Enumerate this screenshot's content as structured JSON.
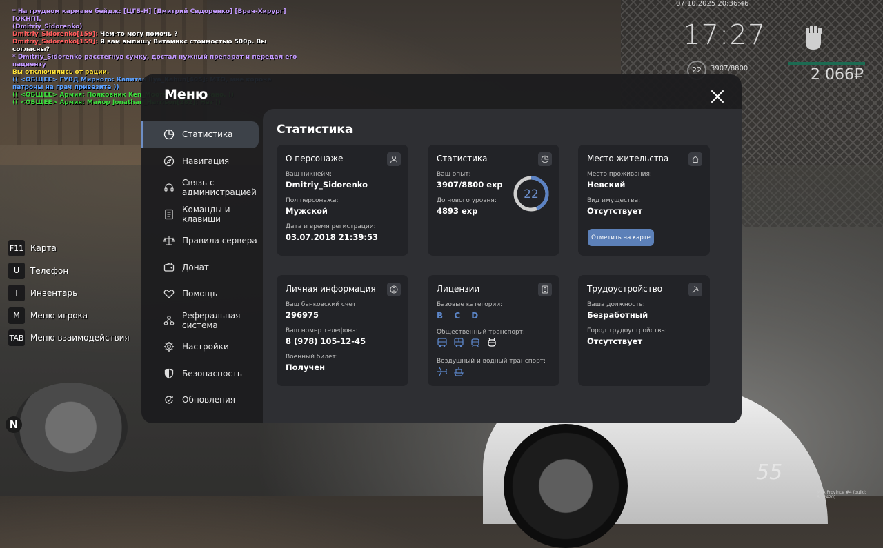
{
  "chat": [
    {
      "color": "purple",
      "text": "* На грудном кармане бейдж: [ЦГБ-Н] [Дмитрий Сидоренко] [Врач-Хирург] [ОКНП]."
    },
    {
      "color": "purple",
      "text": "(Dmitriy_Sidorenko)"
    },
    {
      "color": "red",
      "name": "Dmitriy_Sidorenko[159]:",
      "text": " Чем-то могу помочь ?"
    },
    {
      "color": "red",
      "name": "Dmitriy_Sidorenko[159]:",
      "text": " Я вам выпишу Витамикс стоимостью 500р. Вы согласны?"
    },
    {
      "color": "purple",
      "text": "* Dmitriy_Sidorenko расстегнув сумку, достал нужный препарат и передал его пациенту"
    },
    {
      "color": "yellow",
      "text": "Вы отключились от рации."
    },
    {
      "color": "blue",
      "text": "(( <ОБЩЕЕ> ГУВД Мирного: Капитан Ilya_Kahun[405]: МТО, мне короче патроны на грач привезите ))"
    },
    {
      "color": "green",
      "text": "(( <ОБЩЕЕ> Армия: Полковник Ken_Moore[289]: Отказано. ))"
    },
    {
      "color": "green",
      "text": "(( <ОБЩЕЕ> Армия: Майор Jonathan_Harrison[282]: Нет ))"
    }
  ],
  "hud": {
    "datetime": "07.10.2025 20:36:46",
    "clock": "17:27",
    "level": "22",
    "exp": "3907/8800",
    "money": "2 066₽",
    "speed": "55",
    "build": "MTA Province #4 (build: 6.12420)"
  },
  "hotkeys": [
    {
      "key": "F11",
      "label": "Карта"
    },
    {
      "key": "U",
      "label": "Телефон"
    },
    {
      "key": "I",
      "label": "Инвентарь"
    },
    {
      "key": "M",
      "label": "Меню игрока"
    },
    {
      "key": "TAB",
      "label": "Меню взаимодействия"
    }
  ],
  "minimap": {
    "north": "N"
  },
  "menu": {
    "title": "Меню",
    "nav": [
      {
        "label": "Статистика",
        "icon": "pie-chart-icon",
        "active": true
      },
      {
        "label": "Навигация",
        "icon": "compass-icon"
      },
      {
        "label": "Связь с администрацией",
        "icon": "headset-icon"
      },
      {
        "label": "Команды и клавиши",
        "icon": "document-icon"
      },
      {
        "label": "Правила сервера",
        "icon": "scales-icon"
      },
      {
        "label": "Донат",
        "icon": "wallet-icon"
      },
      {
        "label": "Помощь",
        "icon": "handshake-icon"
      },
      {
        "label": "Реферальная система",
        "icon": "network-icon"
      },
      {
        "label": "Настройки",
        "icon": "gear-icon"
      },
      {
        "label": "Безопасность",
        "icon": "shield-icon"
      },
      {
        "label": "Обновления",
        "icon": "refresh-icon"
      }
    ],
    "content_title": "Статистика",
    "character": {
      "title": "О персонаже",
      "nick_label": "Ваш никнейм:",
      "nick": "Dmitriy_Sidorenko",
      "gender_label": "Пол персонажа:",
      "gender": "Мужской",
      "reg_label": "Дата и время регистрации:",
      "reg": "03.07.2018 21:39:53"
    },
    "stats": {
      "title": "Статистика",
      "exp_label": "Ваш опыт:",
      "exp": "3907/8800 exp",
      "next_label": "До нового уровня:",
      "next": "4893 exp",
      "level": "22",
      "progress": 0.444
    },
    "residence": {
      "title": "Место жительства",
      "place_label": "Место проживания:",
      "place": "Невский",
      "property_label": "Вид имущества:",
      "property": "Отсутствует",
      "map_button": "Отметить на карте"
    },
    "personal": {
      "title": "Личная информация",
      "bank_label": "Ваш банковский счет:",
      "bank": "296975",
      "phone_label": "Ваш номер телефона:",
      "phone": "8 (978) 105-12-45",
      "military_label": "Военный билет:",
      "military": "Получен"
    },
    "licenses": {
      "title": "Лицензии",
      "base_label": "Базовые категории:",
      "base": "B C D",
      "public_label": "Общественный транспорт:",
      "public_icons": [
        "bus-icon",
        "bus-icon",
        "tram-icon",
        "trolleybus-icon"
      ],
      "air_label": "Воздушный и водный транспорт:",
      "air_icons": [
        "plane-icon",
        "boat-icon"
      ]
    },
    "job": {
      "title": "Трудоустройство",
      "position_label": "Ваша должность:",
      "position": "Безработный",
      "city_label": "Город трудоустройства:",
      "city": "Отсутствует"
    }
  }
}
